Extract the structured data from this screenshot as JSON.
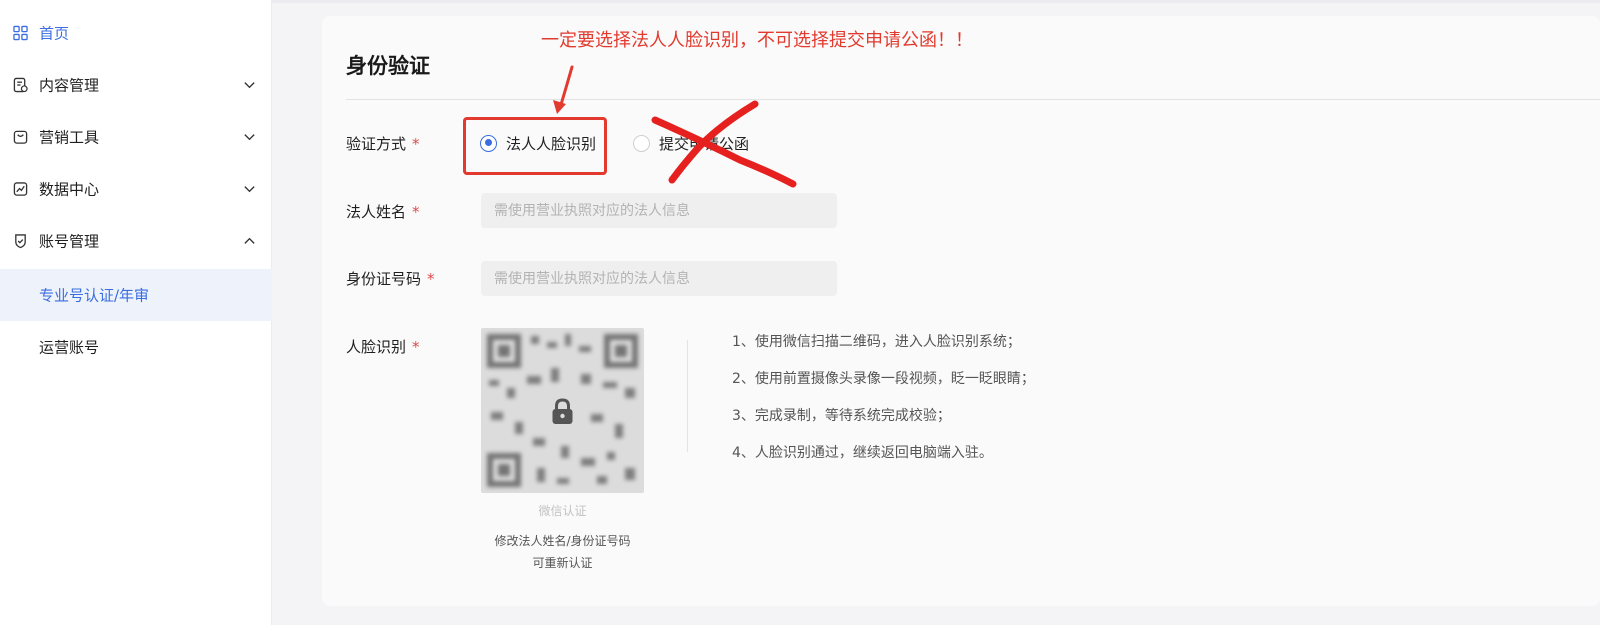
{
  "sidebar": {
    "items": [
      {
        "label": "首页",
        "icon": "grid-icon"
      },
      {
        "label": "内容管理",
        "icon": "document-icon",
        "expanded": false
      },
      {
        "label": "营销工具",
        "icon": "bag-icon",
        "expanded": false
      },
      {
        "label": "数据中心",
        "icon": "chart-icon",
        "expanded": false
      },
      {
        "label": "账号管理",
        "icon": "shield-check-icon",
        "expanded": true
      }
    ],
    "sub_items": [
      {
        "label": "专业号认证/年审",
        "selected": true
      },
      {
        "label": "运营账号",
        "selected": false
      }
    ]
  },
  "main": {
    "title": "身份验证",
    "verify_method": {
      "label": "验证方式",
      "required": "*",
      "options": [
        {
          "label": "法人人脸识别",
          "selected": true
        },
        {
          "label": "提交申请公函",
          "selected": false
        }
      ]
    },
    "legal_name": {
      "label": "法人姓名",
      "required": "*",
      "placeholder": "需使用营业执照对应的法人信息",
      "value": ""
    },
    "id_number": {
      "label": "身份证号码",
      "required": "*",
      "placeholder": "需使用营业执照对应的法人信息",
      "value": ""
    },
    "face_recognition": {
      "label": "人脸识别",
      "required": "*",
      "qr_caption": "微信认证",
      "qr_note_line1": "修改法人姓名/身份证号码",
      "qr_note_line2": "可重新认证",
      "steps": [
        "1、使用微信扫描二维码，进入人脸识别系统；",
        "2、使用前置摄像头录像一段视频，眨一眨眼睛；",
        "3、完成录制，等待系统完成校验；",
        "4、人脸识别通过，继续返回电脑端入驻。"
      ]
    }
  },
  "annotation": {
    "text": "一定要选择法人人脸识别，不可选择提交申请公函！！",
    "color": "#e23a2e"
  },
  "colors": {
    "accent": "#3a6ee0",
    "required": "#e04a4a",
    "annotation_red": "#e23a2e"
  }
}
